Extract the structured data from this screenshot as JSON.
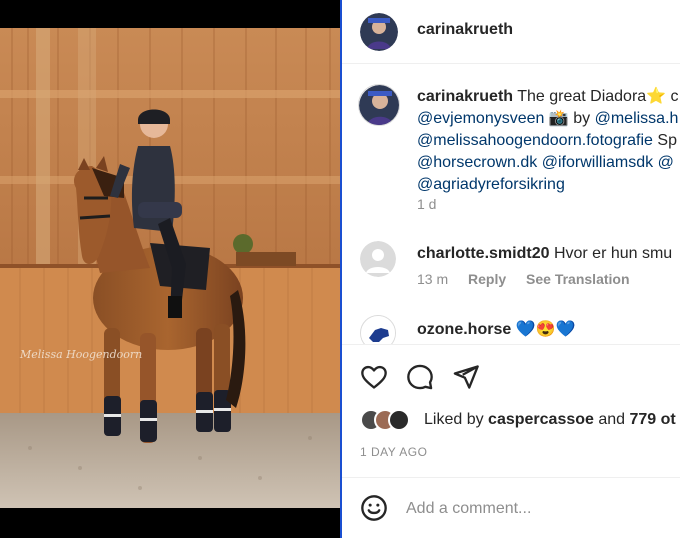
{
  "post": {
    "username": "carinakrueth",
    "photo_watermark": "Melissa Hoogendoorn"
  },
  "caption": {
    "username": "carinakrueth",
    "line1_text": "The great Diadora",
    "line1_star": "⭐",
    "line1_tail": " c",
    "line2_mention1": "@evjemonysveen",
    "line2_camera": "📸",
    "line2_by": " by ",
    "line2_mention2": "@melissa.h",
    "line3_mention": "@melissahoogendoorn.fotografie",
    "line3_tail": " Sp",
    "line4_mention1": "@horsecrown.dk",
    "line4_mention2": "@iforwilliamsdk",
    "line4_mention3": "@",
    "line5_mention": "@agriadyreforsikring",
    "time": "1 d"
  },
  "comments": [
    {
      "username": "charlotte.smidt20",
      "text": "Hvor er hun smu",
      "time": "13 m",
      "reply_label": "Reply",
      "translate_label": "See Translation"
    },
    {
      "username": "ozone.horse",
      "text": "💙😍💙"
    }
  ],
  "actions": {
    "like_icon": "heart-icon",
    "comment_icon": "comment-bubble-icon",
    "share_icon": "paper-plane-icon"
  },
  "likes": {
    "prefix": "Liked by ",
    "user": "caspercassoe",
    "middle": " and ",
    "count": "779 ot"
  },
  "date": "1 DAY AGO",
  "comment_input": {
    "placeholder": "Add a comment..."
  },
  "colors": {
    "mention": "#00376b",
    "muted": "#8e8e8e",
    "text": "#262626",
    "divider_blue": "#1a4fd1"
  }
}
